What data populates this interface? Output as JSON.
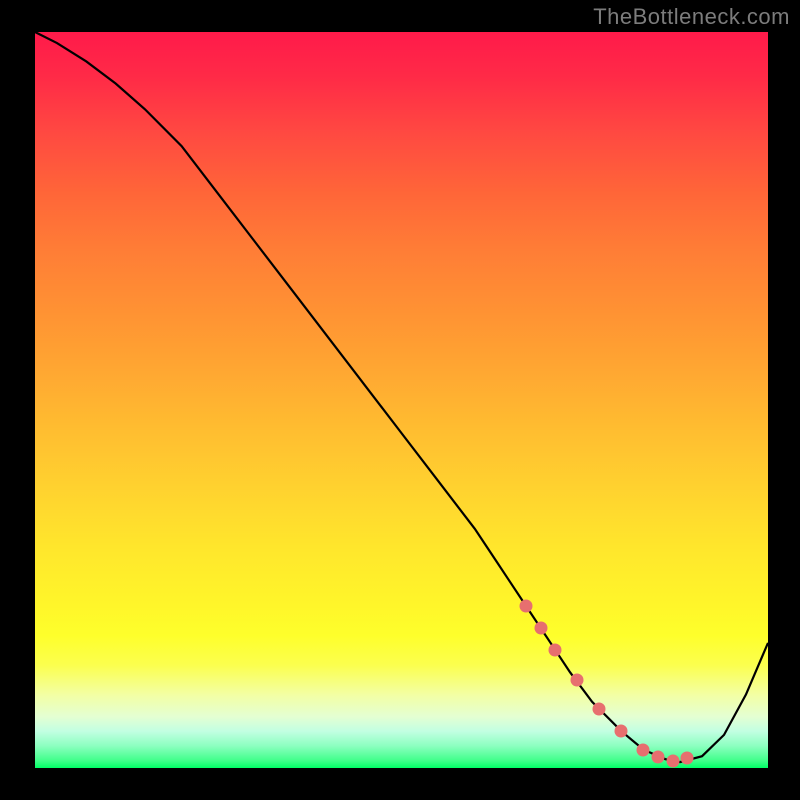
{
  "watermark": "TheBottleneck.com",
  "chart_data": {
    "type": "line",
    "title": "",
    "xlabel": "",
    "ylabel": "",
    "xlim": [
      0,
      100
    ],
    "ylim": [
      0,
      100
    ],
    "series": [
      {
        "name": "curve",
        "color": "#000000",
        "x": [
          0,
          3,
          7,
          11,
          15,
          20,
          25,
          30,
          35,
          40,
          45,
          50,
          55,
          60,
          63,
          67,
          70,
          73,
          76,
          80,
          83,
          86,
          88,
          91,
          94,
          97,
          100
        ],
        "y": [
          100,
          98.5,
          96,
          93,
          89.5,
          84.5,
          78,
          71.5,
          65,
          58.5,
          52,
          45.5,
          39,
          32.5,
          28,
          22,
          17.5,
          13,
          9,
          5,
          2.5,
          1.2,
          0.8,
          1.6,
          4.5,
          10,
          17
        ]
      },
      {
        "name": "optimal-range-dots",
        "color": "#e76f6f",
        "x": [
          67,
          69,
          71,
          74,
          77,
          80,
          83,
          85,
          87,
          89
        ],
        "y": [
          22,
          19,
          16,
          12,
          8,
          5,
          2.5,
          1.5,
          1,
          1.3
        ]
      }
    ]
  }
}
